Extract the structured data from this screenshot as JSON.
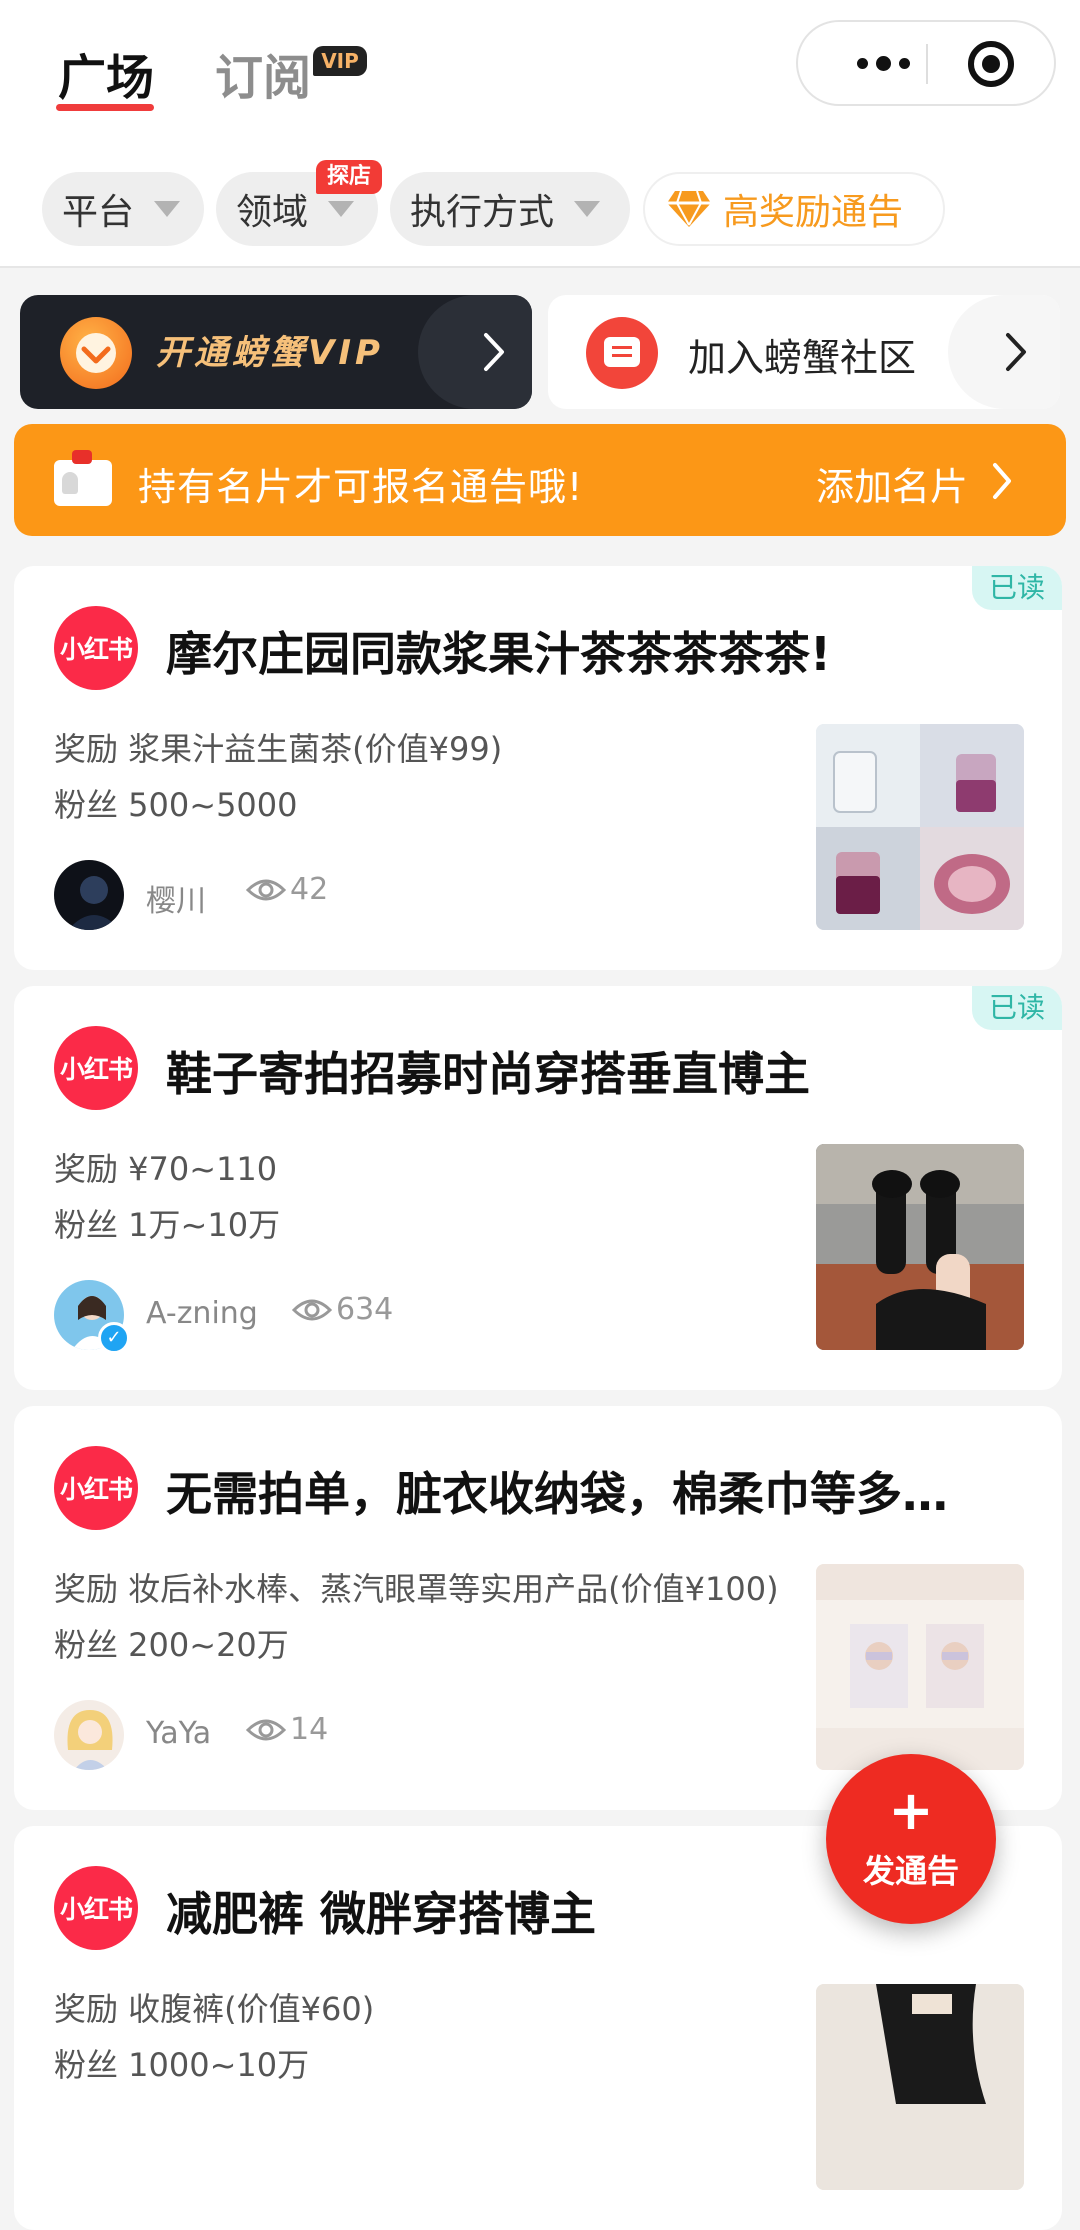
{
  "header": {
    "tabs": [
      {
        "label": "广场",
        "active": true
      },
      {
        "label": "订阅",
        "active": false
      }
    ],
    "vip_badge": "VIP",
    "capsule": {
      "more_icon": "more-dots-icon",
      "close_icon": "miniprogram-target-icon"
    }
  },
  "filters": [
    {
      "label": "平台",
      "icon": "caret-down-icon"
    },
    {
      "label": "领域",
      "icon": "caret-down-icon",
      "badge": "探店"
    },
    {
      "label": "执行方式",
      "icon": "caret-down-icon"
    },
    {
      "label": "高奖励通告",
      "icon": "diamond-icon"
    }
  ],
  "banners": {
    "vip": {
      "label": "开通螃蟹VIP"
    },
    "community": {
      "label": "加入螃蟹社区"
    }
  },
  "notice": {
    "text": "持有名片才可报名通告哦!",
    "action": "添加名片"
  },
  "platform_logo_text": "小红书",
  "posts": [
    {
      "read": "已读",
      "title": "摩尔庄园同款浆果汁茶茶茶茶茶!",
      "reward": "奖励 浆果汁益生菌茶(价值¥99)",
      "fans": "粉丝 500~5000",
      "author": "樱川",
      "views": "42"
    },
    {
      "read": "已读",
      "title": "鞋子寄拍招募时尚穿搭垂直博主",
      "reward": "奖励 ¥70~110",
      "fans": "粉丝 1万~10万",
      "author": "A-zning",
      "views": "634",
      "verified": true
    },
    {
      "title": "无需拍单，脏衣收纳袋，棉柔巾等多…",
      "reward": "奖励 妆后补水棒、蒸汽眼罩等实用产品(价值¥100)",
      "fans": "粉丝 200~20万",
      "author": "YaYa",
      "views": "14"
    },
    {
      "title": "减肥裤 微胖穿搭博主",
      "reward": "奖励 收腹裤(价值¥60)",
      "fans": "粉丝 1000~10万"
    }
  ],
  "fab": {
    "plus": "+",
    "label": "发通告"
  },
  "colors": {
    "accent_red": "#ee2b22",
    "orange": "#fc9716",
    "xhs_red": "#fb2a48",
    "read_teal": "#2fb6a6"
  }
}
